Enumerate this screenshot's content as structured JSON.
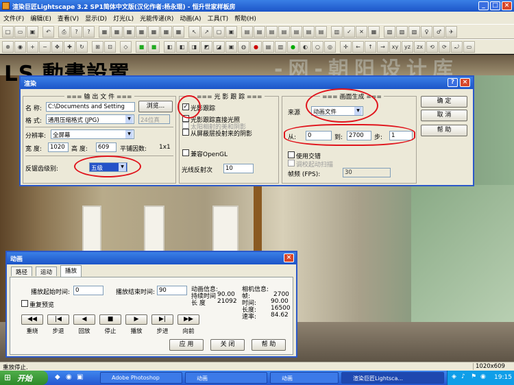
{
  "window": {
    "title": "渲染巨匠Lightscape 3.2 SP1简体中文版(汉化作者:杨永琨) - 恒升世家样板房",
    "min": "_",
    "max": "□",
    "close": "×"
  },
  "menu": [
    "文件(F)",
    "编辑(E)",
    "查看(V)",
    "显示(D)",
    "灯光(L)",
    "光能传递(R)",
    "动画(A)",
    "工具(T)",
    "帮助(H)"
  ],
  "toolbar1": [
    "new",
    "open",
    "save",
    "print",
    "cut",
    "copy",
    "undo",
    "print",
    "help",
    "context-help",
    "select",
    "zoom",
    "pan",
    "orbit",
    "walk",
    "light",
    "render",
    "display",
    "flag",
    "grid",
    "layer",
    "surface",
    "material",
    "camera",
    "view",
    "x",
    "check",
    "light2",
    "walk2",
    "fly",
    "target"
  ],
  "toolbar2": [
    "zoom",
    "zoom-in",
    "zoom-out",
    "pan",
    "move",
    "rotate",
    "refresh",
    "zoom-window",
    "wire",
    "flat",
    "solid",
    "texture",
    "shaded",
    "box1",
    "box2",
    "box3",
    "box4",
    "box5",
    "light",
    "camera",
    "globe",
    "red",
    "layers",
    "film",
    "green",
    "spot",
    "sphere",
    "node",
    "cross",
    "arrow1",
    "arrow2",
    "arrow3",
    "xy",
    "yz",
    "zx",
    "rotx",
    "roty",
    "rotz",
    "ortho"
  ],
  "overlay": {
    "heading": "LS 動畫設置",
    "watermark": "-网-朝阳设计库"
  },
  "render_dialog": {
    "title": "渲染",
    "output": {
      "title": "=== 输 出 文 件 ===",
      "name_label": "名 称:",
      "name_value": "C:\\Documents and Setting",
      "browse": "浏览...",
      "format_label": "格 式:",
      "format_value": "通用压缩格式 (JPG)",
      "bits": "24位真",
      "resolution_label": "分辨率:",
      "resolution_value": "全屏幕",
      "width_label": "宽 度:",
      "width_value": "1020",
      "height_label": "高 度:",
      "height_value": "609",
      "tile_label": "平铺因数:",
      "tile_value": "1x1",
      "aa_label": "反锯齿级别:",
      "aa_value": "五级"
    },
    "ray": {
      "title": "=== 光 影 跟 踪 ===",
      "raytrace": "光影跟踪",
      "direct": "光影跟踪直接光照",
      "sun": "太阳相射的美和阴影",
      "shadow": "从屏蔽层投射来的阴影",
      "opengl": "兼容OpenGL",
      "reflect_label": "光线反射次",
      "reflect_value": "10"
    },
    "frames": {
      "title": "=== 画面生成 ===",
      "source_label": "来源",
      "source_value": "动画文件",
      "from_label": "从:",
      "from_value": "0",
      "to_label": "到:",
      "to_value": "2700",
      "step_label": "步:",
      "step_value": "1",
      "interlace": "使用交错",
      "interlace_sub": "调校起动扫描",
      "fps_label": "帧频 (FPS):",
      "fps_value": "30"
    },
    "ok": "确 定",
    "cancel": "取 消",
    "help": "帮 助"
  },
  "anim_dialog": {
    "title": "动画",
    "tabs": [
      "路径",
      "运动",
      "播放"
    ],
    "start_label": "播放起始时间:",
    "start_value": "0",
    "end_label": "播放结束时间:",
    "end_value": "90",
    "loop": "重复预览",
    "anim_info_title": "动画信息:",
    "anim_info": [
      [
        "持续时间",
        "90.00"
      ],
      [
        "长    度",
        "21092"
      ]
    ],
    "cam_info_title": "相机信息:",
    "cam_info": [
      [
        "帧:",
        "2700"
      ],
      [
        "时间:",
        "90.00"
      ],
      [
        "长度:",
        "16500"
      ],
      [
        "速率:",
        "84.62"
      ]
    ],
    "controls": [
      {
        "sym": "◀◀",
        "label": "重绕"
      },
      {
        "sym": "|◀",
        "label": "步退"
      },
      {
        "sym": "◀",
        "label": "回放"
      },
      {
        "sym": "■",
        "label": "停止"
      },
      {
        "sym": "▶",
        "label": "播放"
      },
      {
        "sym": "▶|",
        "label": "步进"
      },
      {
        "sym": "▶▶",
        "label": "向前"
      }
    ],
    "apply": "应 用",
    "close": "关 闭",
    "help": "帮 助"
  },
  "statusbar": {
    "text": "重放停止.",
    "size": "1020x609"
  },
  "taskbar": {
    "start": "开始",
    "tasks": [
      "Adobe Photoshop",
      "动画",
      "动画",
      "渲染巨匠Lightsca..."
    ],
    "clock": "19:15"
  },
  "colors": {
    "highlight": "#e0141c",
    "titlebar": "#1c55c8",
    "dialog_bg": "#ece9d8"
  }
}
